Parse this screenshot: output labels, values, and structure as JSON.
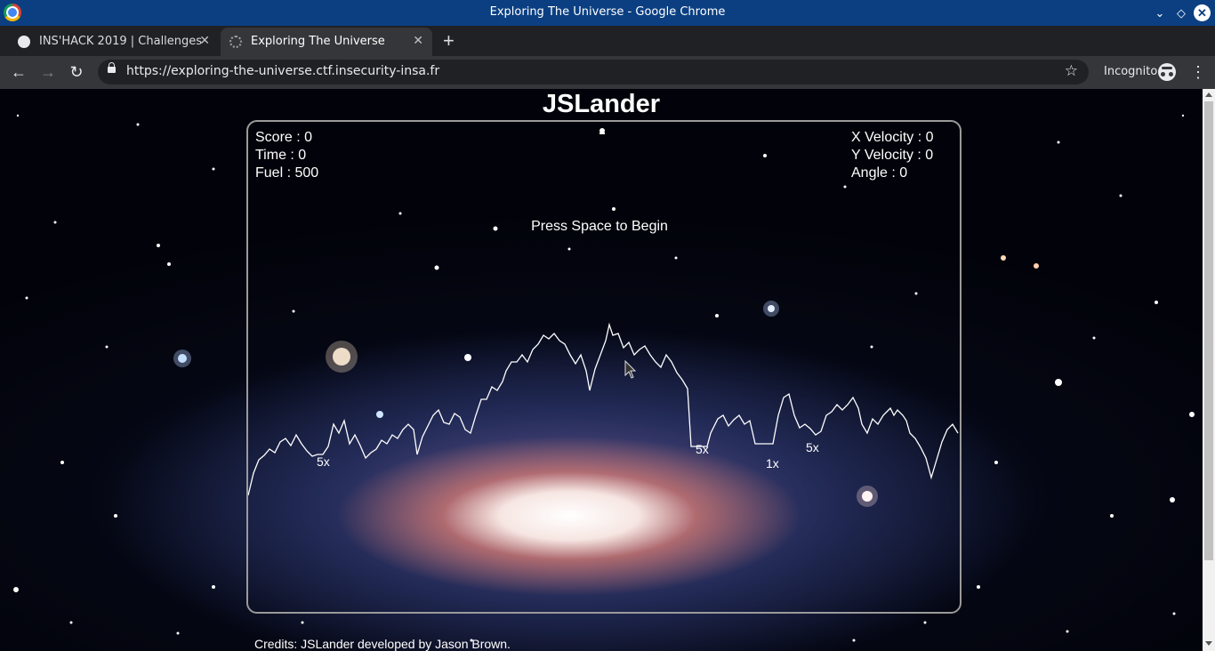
{
  "window": {
    "title": "Exploring The Universe - Google Chrome"
  },
  "tabs": [
    {
      "label": "INS'HACK 2019 | Challenges",
      "active": false
    },
    {
      "label": "Exploring The Universe",
      "active": true
    }
  ],
  "toolbar": {
    "url": "https://exploring-the-universe.ctf.insecurity-insa.fr",
    "incognito_label": "Incognito"
  },
  "page": {
    "title": "JSLander",
    "credits": "Credits: JSLander developed by Jason Brown."
  },
  "game": {
    "score_label": "Score : 0",
    "time_label": "Time : 0",
    "fuel_label": "Fuel : 500",
    "x_velocity_label": "X Velocity : 0",
    "y_velocity_label": "Y Velocity : 0",
    "angle_label": "Angle : 0",
    "prompt": "Press Space to Begin",
    "pad_multipliers": [
      "5x",
      "5x",
      "1x",
      "5x"
    ]
  },
  "colors": {
    "titlebar": "#0b3f82",
    "tabstrip": "#202124",
    "toolbar": "#35363a",
    "game_line": "#ffffff"
  },
  "icons": [
    "chrome-logo-icon",
    "tab-favicon-icon",
    "back-icon",
    "forward-icon",
    "reload-icon",
    "lock-icon",
    "star-icon",
    "incognito-icon",
    "menu-icon",
    "lander-icon"
  ]
}
